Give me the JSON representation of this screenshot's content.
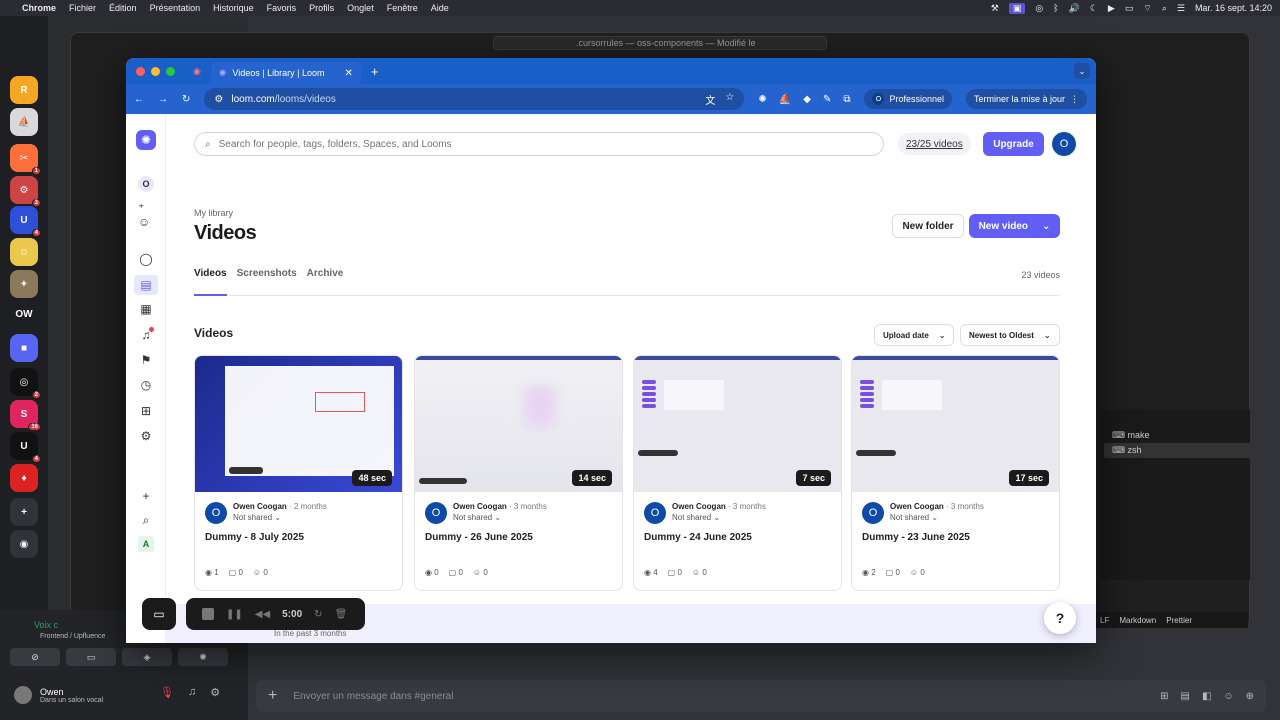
{
  "menubar": {
    "app": "Chrome",
    "items": [
      "Fichier",
      "Édition",
      "Présentation",
      "Historique",
      "Favoris",
      "Profils",
      "Onglet",
      "Fenêtre",
      "Aide"
    ],
    "datetime": "Mar. 16 sept.  14:20"
  },
  "discord": {
    "servers": [
      {
        "label": "R",
        "bg": "#f5a623",
        "badge": ""
      },
      {
        "label": "⛵",
        "bg": "#d9d9d9",
        "badge": ""
      },
      {
        "label": "✂",
        "bg": "#ff6f3c",
        "badge": "1"
      },
      {
        "label": "⚙",
        "bg": "#c44",
        "badge": "3"
      },
      {
        "label": "U",
        "bg": "#2e4fd8",
        "badge": "4"
      },
      {
        "label": "☺",
        "bg": "#e9c84b",
        "badge": ""
      },
      {
        "label": "✦",
        "bg": "#8b7a5a",
        "badge": ""
      },
      {
        "label": "OW",
        "bg": "#1e1f22",
        "badge": ""
      },
      {
        "label": "■",
        "bg": "#5865f2",
        "badge": ""
      },
      {
        "label": "◎",
        "bg": "#111",
        "badge": "2"
      },
      {
        "label": "S",
        "bg": "#e0245e",
        "badge": "16"
      },
      {
        "label": "U",
        "bg": "#111",
        "badge": "4"
      },
      {
        "label": "♦",
        "bg": "#d22",
        "badge": ""
      },
      {
        "label": "+",
        "bg": "#313338",
        "badge": ""
      },
      {
        "label": "◉",
        "bg": "#313338",
        "badge": ""
      }
    ],
    "voice_status": "Voix c",
    "voice_channel": "Frontend / Upfluence",
    "user_name": "Owen",
    "user_status": "Dans un salon vocal",
    "message_placeholder": "Envoyer un message dans #general"
  },
  "editor": {
    "title": ".cursorrules — oss-components — Modifié le",
    "terminals": [
      "make",
      "zsh"
    ],
    "status_items": [
      "LF",
      "Markdown",
      "Prettier"
    ]
  },
  "browser": {
    "tab_title": "Videos | Library | Loom",
    "url_domain": "loom.com",
    "url_path": "/looms/videos",
    "profile_label": "Professionnel",
    "profile_initial": "O",
    "update_label": "Terminer la mise à jour"
  },
  "loom": {
    "search_placeholder": "Search for people, tags, folders, Spaces, and Looms",
    "video_quota": "23/25 videos",
    "upgrade_label": "Upgrade",
    "avatar_initial": "O",
    "breadcrumb": "My library",
    "page_title": "Videos",
    "new_folder_label": "New folder",
    "new_video_label": "New video",
    "tabs": [
      "Videos",
      "Screenshots",
      "Archive"
    ],
    "video_count": "23 videos",
    "section_title": "Videos",
    "sort_field": "Upload date",
    "sort_order": "Newest to Oldest",
    "sidebar_workspace_initial": "O",
    "sidebar_bottom_initial": "A",
    "banner_text": "In the past 3 months",
    "videos": [
      {
        "title": "Dummy - 8 July 2025",
        "duration": "48 sec",
        "author": "Owen Coogan",
        "age": "2 months",
        "sharing": "Not shared",
        "views": "1",
        "comments": "0",
        "reactions": "0",
        "theme": "dark"
      },
      {
        "title": "Dummy - 26 June 2025",
        "duration": "14 sec",
        "author": "Owen Coogan",
        "age": "3 months",
        "sharing": "Not shared",
        "views": "0",
        "comments": "0",
        "reactions": "0",
        "theme": "light"
      },
      {
        "title": "Dummy - 24 June 2025",
        "duration": "7 sec",
        "author": "Owen Coogan",
        "age": "3 months",
        "sharing": "Not shared",
        "views": "4",
        "comments": "0",
        "reactions": "0",
        "theme": "purple"
      },
      {
        "title": "Dummy - 23 June 2025",
        "duration": "17 sec",
        "author": "Owen Coogan",
        "age": "3 months",
        "sharing": "Not shared",
        "views": "2",
        "comments": "0",
        "reactions": "0",
        "theme": "purple"
      }
    ]
  },
  "recorder": {
    "time": "5:00"
  },
  "colors": {
    "loom_purple": "#625df5",
    "chrome_blue": "#2564cf",
    "discord_bg": "#1e1f22"
  }
}
